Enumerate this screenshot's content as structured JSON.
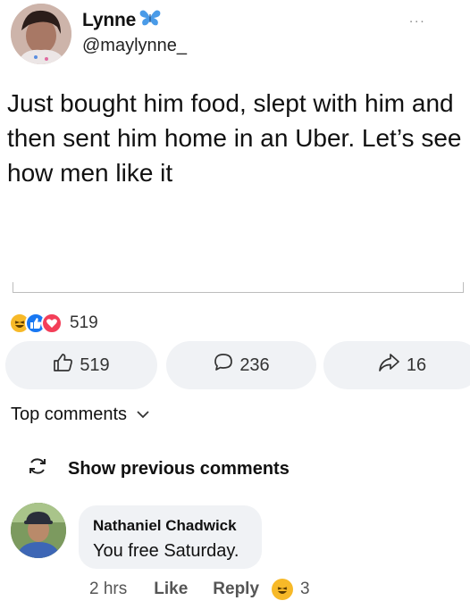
{
  "tweet": {
    "author_name": "Lynne",
    "handle": "@maylynne_",
    "more_label": "...",
    "text_lines": [
      "Just bought him food, slept with him and",
      "then sent him home in an Uber. Let’s see",
      "how men like it"
    ],
    "icons": {
      "verified": "butterfly-icon"
    }
  },
  "reactions": {
    "types": [
      "haha",
      "like",
      "love"
    ],
    "count": "519",
    "colors": {
      "haha": "#f7b928",
      "like": "#1877f2",
      "love": "#f33e58"
    }
  },
  "actions": {
    "like_count": "519",
    "comment_count": "236",
    "share_count": "16",
    "icons": {
      "like": "thumbs-up-icon",
      "comment": "speech-bubble-icon",
      "share": "share-arrow-icon"
    }
  },
  "comments_header": {
    "sort_label": "Top comments",
    "show_previous_label": "Show previous comments"
  },
  "comment": {
    "author": "Nathaniel Chadwick",
    "text": "You free Saturday.",
    "time": "2 hrs",
    "like_label": "Like",
    "reply_label": "Reply",
    "reaction_count": "3"
  }
}
